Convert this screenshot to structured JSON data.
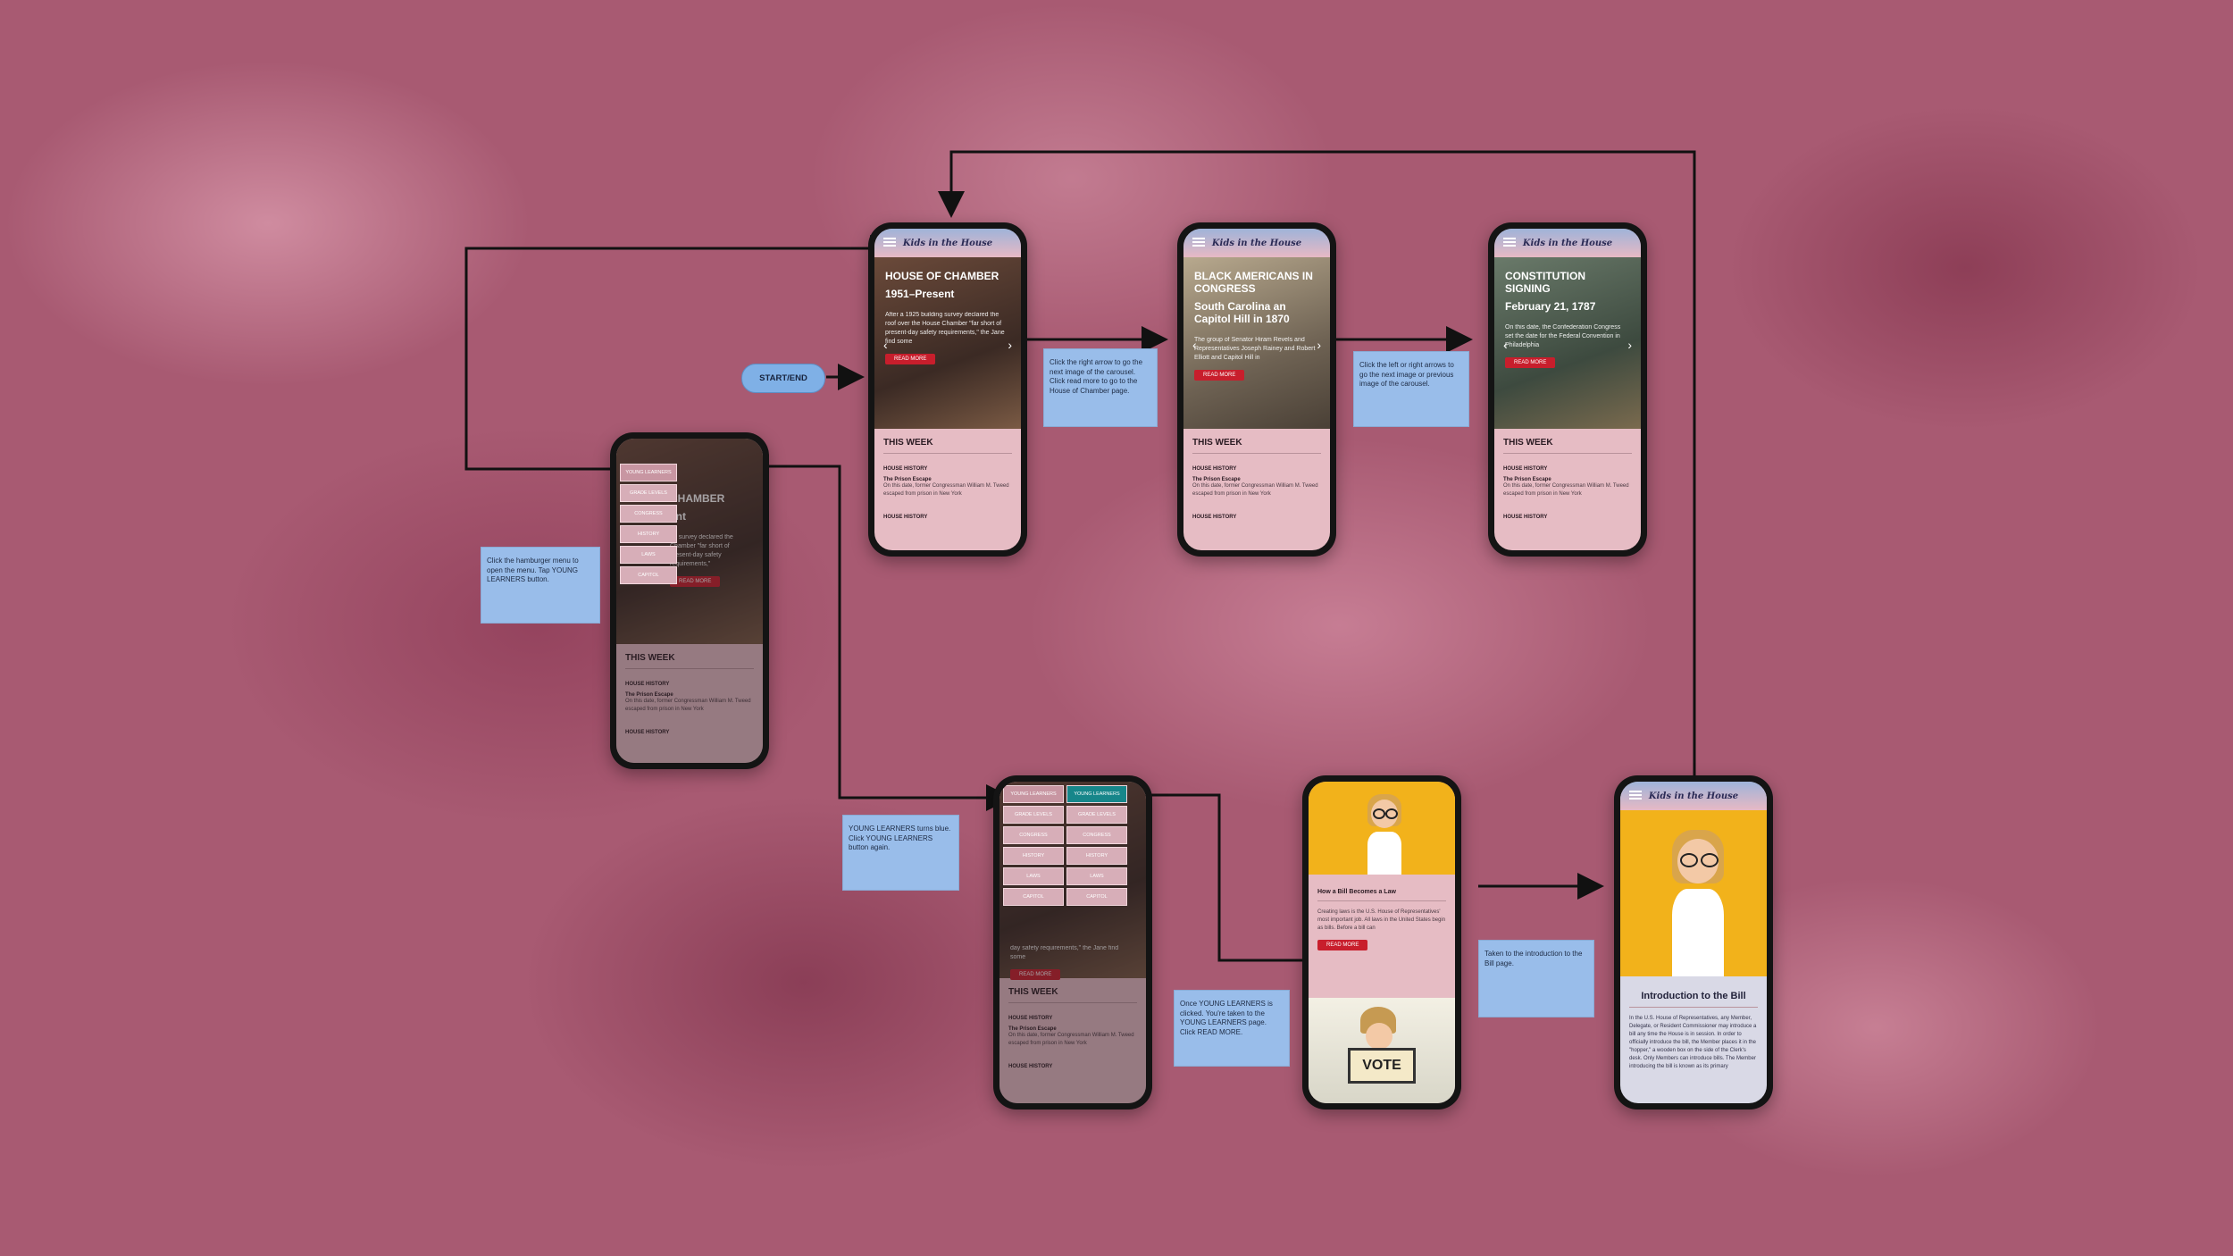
{
  "brand": "Kids in the House",
  "start_end": "START/END",
  "phones": {
    "carousel1": {
      "title": "HOUSE OF CHAMBER",
      "subtitle": "1951–Present",
      "text": "After a 1925 building survey declared the roof over the House Chamber \"far short of present-day safety requirements,\" the Jane find some",
      "button": "READ MORE"
    },
    "carousel2": {
      "title": "BLACK AMERICANS IN CONGRESS",
      "subtitle": "South Carolina an Capitol Hill in 1870",
      "text": "The group of Senator Hiram Revels and Representatives Joseph Rainey and Robert Elliott and Capitol Hill in",
      "button": "READ MORE"
    },
    "carousel3": {
      "title": "CONSTITUTION SIGNING",
      "subtitle": "February 21, 1787",
      "text": "On this date, the Confederation Congress set the date for the Federal Convention in Philadelphia",
      "button": "READ MORE"
    },
    "menu_phone": {
      "bg_title": "CHAMBER",
      "bg_sub": "ent",
      "bg_text": "ng survey declared the Chamber \"far short of present-day safety requirements,\"",
      "button": "READ MORE",
      "menu": [
        "YOUNG LEARNERS",
        "GRADE LEVELS",
        "CONGRESS",
        "HISTORY",
        "LAWS",
        "CAPITOL"
      ]
    },
    "menu_phone2": {
      "menu_left": [
        "YOUNG LEARNERS",
        "GRADE LEVELS",
        "CONGRESS",
        "HISTORY",
        "LAWS",
        "CAPITOL"
      ],
      "menu_right": [
        "YOUNG LEARNERS",
        "GRADE LEVELS",
        "CONGRESS",
        "HISTORY",
        "LAWS",
        "CAPITOL"
      ],
      "bg_text": "day safety requirements,\" the Jane find some",
      "button": "READ MORE"
    },
    "young_learners": {
      "title": "How a Bill Becomes a Law",
      "text": "Creating laws is the U.S. House of Representatives' most important job. All laws in the United States begin as bills. Before a bill can",
      "button": "READ MORE",
      "vote": "VOTE"
    },
    "intro_bill": {
      "title": "Introduction to the Bill",
      "text": "In the U.S. House of Representatives, any Member, Delegate, or Resident Commissioner may introduce a bill any time the House is in session. In order to officially introduce the bill, the Member places it in the \"hopper,\" a wooden box on the side of the Clerk's desk. Only Members can introduce bills. The Member introducing the bill is known as its primary"
    },
    "this_week": {
      "heading": "THIS WEEK",
      "category": "HOUSE HISTORY",
      "item_title": "The Prison Escape",
      "item_desc": "On this date, former Congressman William M. Tweed escaped from prison in New York",
      "footer": "HOUSE HISTORY"
    }
  },
  "notes": {
    "n1": "Click the right arrow to go the next image of the carousel. Click read more to go to the House of Chamber page.",
    "n2": "Click the left or right arrows to go the next image or previous image of the carousel.",
    "n3": "Click the hamburger menu to open the menu. Tap YOUNG LEARNERS button.",
    "n4": "YOUNG LEARNERS turns blue. Click YOUNG LEARNERS button again.",
    "n5": "Once YOUNG LEARNERS is clicked. You're taken to the YOUNG LEARNERS page. Click READ MORE.",
    "n6": "Taken to the introduction to the Bill page."
  }
}
